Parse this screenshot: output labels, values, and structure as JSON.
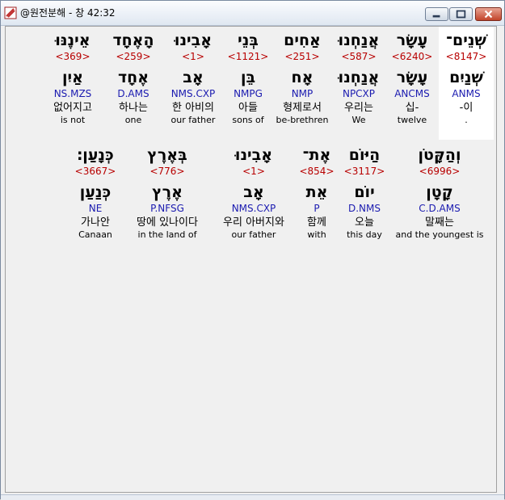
{
  "window": {
    "title": "@원전분해 - 창 42:32"
  },
  "rows": [
    [
      {
        "surface": "שְׁנֵים־",
        "strong": "<8147>",
        "lemma": "שְׁנַיִם",
        "morph": "ANMS",
        "kor": "-이",
        "eng": ".",
        "selected": true
      },
      {
        "surface": "עָשָׂר",
        "strong": "<6240>",
        "lemma": "עָשָׂר",
        "morph": "ANCMS",
        "kor": "십-",
        "eng": "twelve"
      },
      {
        "surface": "אֲנַחְנוּ",
        "strong": "<587>",
        "lemma": "אֲנַחְנוּ",
        "morph": "NPCXP",
        "kor": "우리는",
        "eng": "We"
      },
      {
        "surface": "אַחִים",
        "strong": "<251>",
        "lemma": "אָח",
        "morph": "NMP",
        "kor": "형제로서",
        "eng": "be-brethren"
      },
      {
        "surface": "בְּנֵי",
        "strong": "<1121>",
        "lemma": "בֵּן",
        "morph": "NMPG",
        "kor": "아들",
        "eng": "sons of"
      },
      {
        "surface": "אָבִינוּ",
        "strong": "<1>",
        "lemma": "אָב",
        "morph": "NMS.CXP",
        "kor": "한 아비의",
        "eng": "our father"
      },
      {
        "surface": "הָאֶחָד",
        "strong": "<259>",
        "lemma": "אֶחָד",
        "morph": "D.AMS",
        "kor": "하나는",
        "eng": "one"
      },
      {
        "surface": "אֵינֶנּוּ",
        "strong": "<369>",
        "lemma": "אַיִן",
        "morph": "NS.MZS",
        "kor": "없어지고",
        "eng": "is not"
      }
    ],
    [
      {
        "surface": "וְהַקָּטֹן",
        "strong": "<6996>",
        "lemma": "קָטָן",
        "morph": "C.D.AMS",
        "kor": "말째는",
        "eng": "and the youngest is"
      },
      {
        "surface": "הַיּוֹם",
        "strong": "<3117>",
        "lemma": "יוֹם",
        "morph": "D.NMS",
        "kor": "오늘",
        "eng": "this day"
      },
      {
        "surface": "אֶת־",
        "strong": "<854>",
        "lemma": "אֵת",
        "morph": "P",
        "kor": "함께",
        "eng": "with"
      },
      {
        "surface": "אָבִינוּ",
        "strong": "<1>",
        "lemma": "אָב",
        "morph": "NMS.CXP",
        "kor": "우리 아버지와",
        "eng": "our father"
      },
      {
        "surface": "בְּאֶרֶץ",
        "strong": "<776>",
        "lemma": "אֶרֶץ",
        "morph": "P.NFSG",
        "kor": "땅에 있나이다",
        "eng": "in the land of"
      },
      {
        "surface": "כְּנָעַן׃",
        "strong": "<3667>",
        "lemma": "כְּנַעַן",
        "morph": "NE",
        "kor": "가나안",
        "eng": "Canaan"
      }
    ]
  ]
}
